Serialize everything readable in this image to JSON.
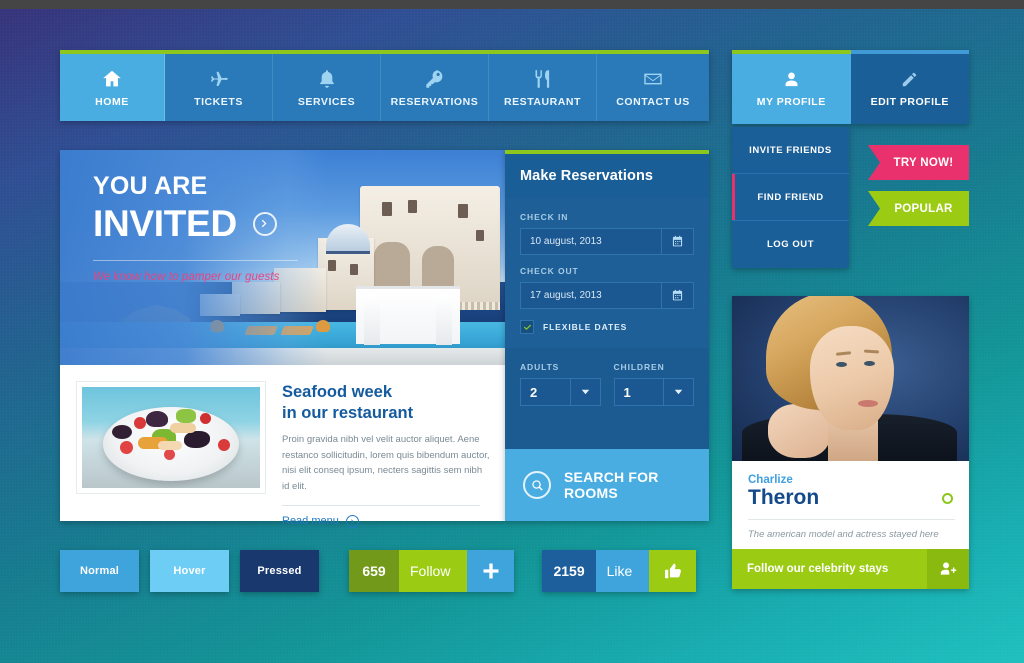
{
  "nav": {
    "items": [
      {
        "label": "HOME",
        "icon": "home-icon",
        "active": true
      },
      {
        "label": "TICKETS",
        "icon": "plane-icon",
        "active": false
      },
      {
        "label": "SERVICES",
        "icon": "bell-icon",
        "active": false
      },
      {
        "label": "RESERVATIONS",
        "icon": "key-icon",
        "active": false
      },
      {
        "label": "RESTAURANT",
        "icon": "cutlery-icon",
        "active": false
      },
      {
        "label": "CONTACT US",
        "icon": "envelope-icon",
        "active": false
      }
    ]
  },
  "hero": {
    "line1": "YOU ARE",
    "line2": "INVITED",
    "subtitle": "We know how to pamper our guests",
    "arrow_icon": "chevron-right-icon"
  },
  "article": {
    "title_line1": "Seafood week",
    "title_line2": "in our restaurant",
    "body": "Proin gravida nibh vel velit auctor aliquet. Aene restanco sollicitudin, lorem quis bibendum auctor, nisi elit conseq ipsum, necters sagittis sem nibh id elit.",
    "link_label": "Read menu",
    "link_icon": "chevron-right-icon",
    "image_alt": "seafood-salad-plate"
  },
  "reservation": {
    "title": "Make Reservations",
    "checkin_label": "CHECK IN",
    "checkin_value": "10 august, 2013",
    "checkout_label": "CHECK OUT",
    "checkout_value": "17 august, 2013",
    "calendar_icon": "calendar-icon",
    "flexible_label": "FLEXIBLE DATES",
    "flexible_checked": true,
    "check_icon": "check-icon",
    "adults_label": "ADULTS",
    "adults_value": "2",
    "children_label": "CHILDREN",
    "children_value": "1",
    "caret_icon": "chevron-down-icon",
    "search_label": "SEARCH FOR ROOMS",
    "search_icon": "magnifier-icon"
  },
  "profile": {
    "tabs": [
      {
        "label": "MY PROFILE",
        "icon": "user-icon",
        "active": true
      },
      {
        "label": "EDIT PROFILE",
        "icon": "pencil-icon",
        "active": false
      }
    ],
    "menu": [
      {
        "label": "INVITE FRIENDS",
        "accent": false
      },
      {
        "label": "FIND FRIEND",
        "accent": true
      },
      {
        "label": "LOG OUT",
        "accent": false
      }
    ]
  },
  "ribbons": [
    {
      "label": "TRY NOW!",
      "color": "#e8316d"
    },
    {
      "label": "POPULAR",
      "color": "#9ccb14"
    }
  ],
  "celebrity": {
    "first_name": "Charlize",
    "last_name": "Theron",
    "note": "The american model and actress stayed here",
    "cta_label": "Follow our celebrity stays",
    "cta_icon": "add-user-icon",
    "status_icon": "status-ring-icon",
    "photo_alt": "charlize-theron-portrait"
  },
  "buttons": {
    "states": [
      {
        "label": "Normal",
        "color": "#3fa3dc"
      },
      {
        "label": "Hover",
        "color": "#6ecdf4"
      },
      {
        "label": "Pressed",
        "color": "#18386e"
      }
    ],
    "follow": {
      "count": "659",
      "label": "Follow",
      "icon": "plus-icon"
    },
    "like": {
      "count": "2159",
      "label": "Like",
      "icon": "thumbs-up-icon"
    }
  },
  "colors": {
    "green": "#8dc71e",
    "lime": "#9ccb14",
    "pink": "#e8316d",
    "blue_light": "#49ade2",
    "blue_dark": "#1b5f99",
    "navy": "#134a8a"
  }
}
